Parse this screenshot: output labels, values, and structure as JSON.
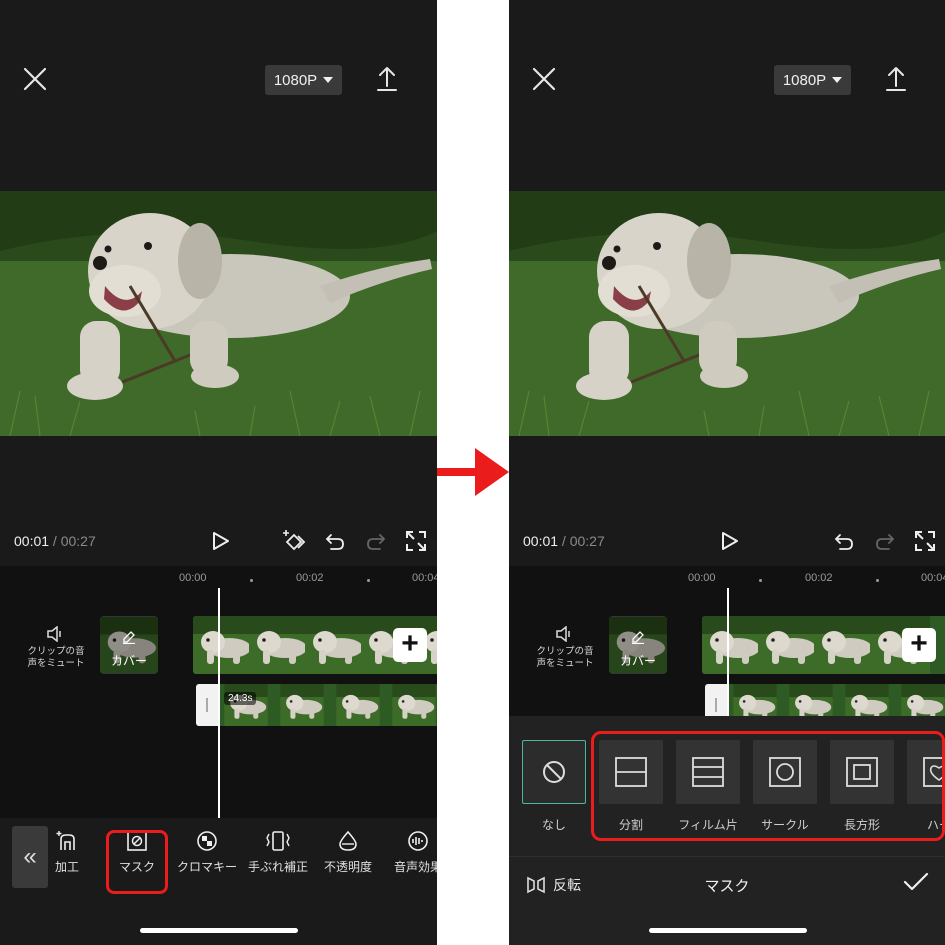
{
  "before": {
    "header": {
      "resolution": "1080P"
    },
    "transport": {
      "current_time": "00:01",
      "separator": " / ",
      "total_time": "00:27"
    },
    "ruler": {
      "t0": "00:00",
      "t1": "00:02",
      "t2": "00:04"
    },
    "tracks": {
      "mute_label_1": "クリップの音",
      "mute_label_2": "声をミュート",
      "cover_label": "カバー",
      "clip_duration": "24.3s",
      "add_symbol": "+"
    },
    "toolbar": {
      "back_symbol": "«",
      "items": [
        {
          "label": "加工",
          "icon": "edit-icon"
        },
        {
          "label": "マスク",
          "icon": "mask-icon"
        },
        {
          "label": "クロマキー",
          "icon": "chroma-key-icon"
        },
        {
          "label": "手ぶれ補正",
          "icon": "stabilize-icon"
        },
        {
          "label": "不透明度",
          "icon": "opacity-icon"
        },
        {
          "label": "音声効果",
          "icon": "voice-effect-icon"
        }
      ]
    }
  },
  "after": {
    "header": {
      "resolution": "1080P"
    },
    "transport": {
      "current_time": "00:01",
      "separator": " / ",
      "total_time": "00:27"
    },
    "ruler": {
      "t0": "00:00",
      "t1": "00:02",
      "t2": "00:04"
    },
    "tracks": {
      "mute_label_1": "クリップの音",
      "mute_label_2": "声をミュート",
      "cover_label": "カバー",
      "add_symbol": "+"
    },
    "mask_panel": {
      "options": [
        {
          "label": "なし",
          "icon": "none-icon"
        },
        {
          "label": "分割",
          "icon": "split-icon"
        },
        {
          "label": "フィルム片",
          "icon": "film-strip-icon"
        },
        {
          "label": "サークル",
          "icon": "circle-icon"
        },
        {
          "label": "長方形",
          "icon": "rectangle-icon"
        },
        {
          "label": "ハー",
          "icon": "heart-icon"
        }
      ],
      "invert_label": "反転",
      "title": "マスク"
    }
  },
  "colors": {
    "highlight": "#ea1c1c",
    "selection": "#4fb5a0",
    "background": "#1a1a1a"
  }
}
